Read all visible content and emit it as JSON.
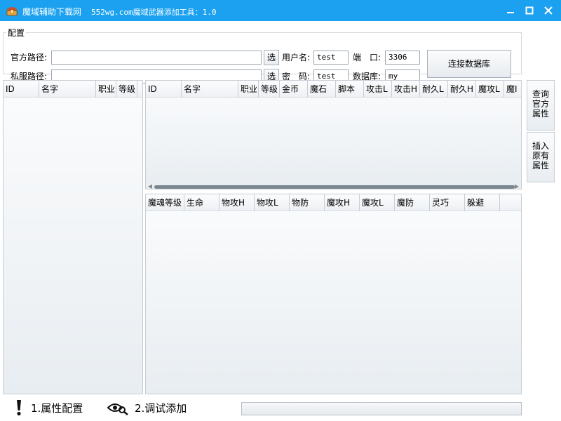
{
  "window": {
    "title": "魔域辅助下载网",
    "subtitle": "552wg.com魔域武器添加工具：1.0",
    "accent": "#1ba1ef"
  },
  "config": {
    "legend": "配置",
    "official_path_label": "官方路径:",
    "official_path_value": "",
    "private_path_label": "私服路径:",
    "private_path_value": "",
    "select_label": "选",
    "username_label": "用户名:",
    "username_value": "test",
    "password_label": "密　码:",
    "password_value": "test",
    "port_label": "端　口:",
    "port_value": "3306",
    "database_label": "数据库:",
    "database_value": "my",
    "connect_button": "连接数据库"
  },
  "left_table": {
    "columns": [
      "ID",
      "名字",
      "职业",
      "等级"
    ]
  },
  "top_table": {
    "columns": [
      "ID",
      "名字",
      "职业",
      "等级",
      "金币",
      "魔石",
      "脚本",
      "攻击L",
      "攻击H",
      "耐久L",
      "耐久H",
      "魔攻L",
      "魔I"
    ]
  },
  "bottom_table": {
    "columns": [
      "魔魂等级",
      "生命",
      "物攻H",
      "物攻L",
      "物防",
      "魔攻H",
      "魔攻L",
      "魔防",
      "灵巧",
      "躲避"
    ]
  },
  "side_buttons": {
    "query": [
      "查询",
      "官方",
      "属性"
    ],
    "insert": [
      "插入",
      "原有",
      "属性"
    ]
  },
  "tabs": {
    "attr_config": "1.属性配置",
    "debug_add": "2.调试添加"
  },
  "icons": {
    "app": "chest-icon",
    "minimize": "minimize-icon",
    "maximize": "maximize-icon",
    "close": "close-icon",
    "tab1": "exclamation-icon",
    "tab2": "eye-search-icon"
  }
}
